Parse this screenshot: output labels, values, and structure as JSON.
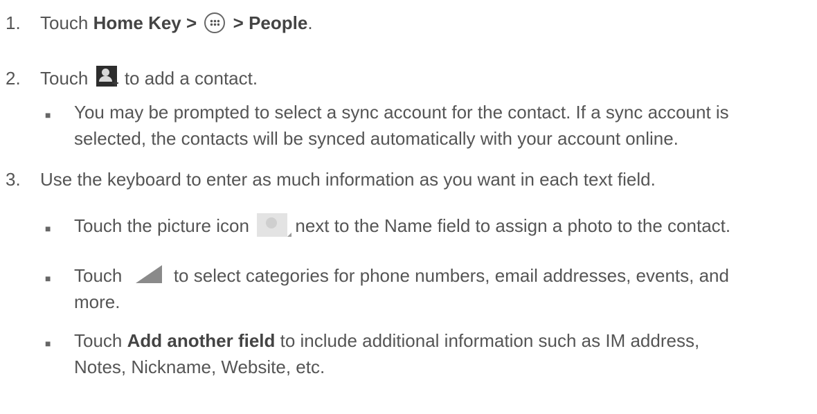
{
  "steps": [
    {
      "number": "1.",
      "parts": [
        "Touch ",
        "Home Key >",
        " > People",
        "."
      ]
    },
    {
      "number": "2.",
      "parts": [
        "Touch ",
        " to add a contact."
      ],
      "bullets": [
        {
          "line1": "You may be prompted to select a sync account for the contact. If a sync account is",
          "line2": "selected, the contacts will be synced automatically with your account online."
        }
      ]
    },
    {
      "number": "3.",
      "text": "Use the keyboard to enter as much information as you want in each text field.",
      "bullets": [
        {
          "before": "Touch the picture icon ",
          "after": " next to the Name field to assign a photo to the contact."
        },
        {
          "before": "Touch ",
          "after": " to select categories for phone numbers, email addresses, events, and",
          "line2": "more."
        },
        {
          "before": "Touch ",
          "bold": "Add another field",
          "after": " to include additional information such as IM address,",
          "line2": "Notes, Nickname, Website, etc."
        }
      ]
    }
  ],
  "icons": [
    "apps-icon",
    "add-contact-icon",
    "picture-icon",
    "triangle-icon"
  ],
  "colors": {
    "text": "#555555"
  }
}
